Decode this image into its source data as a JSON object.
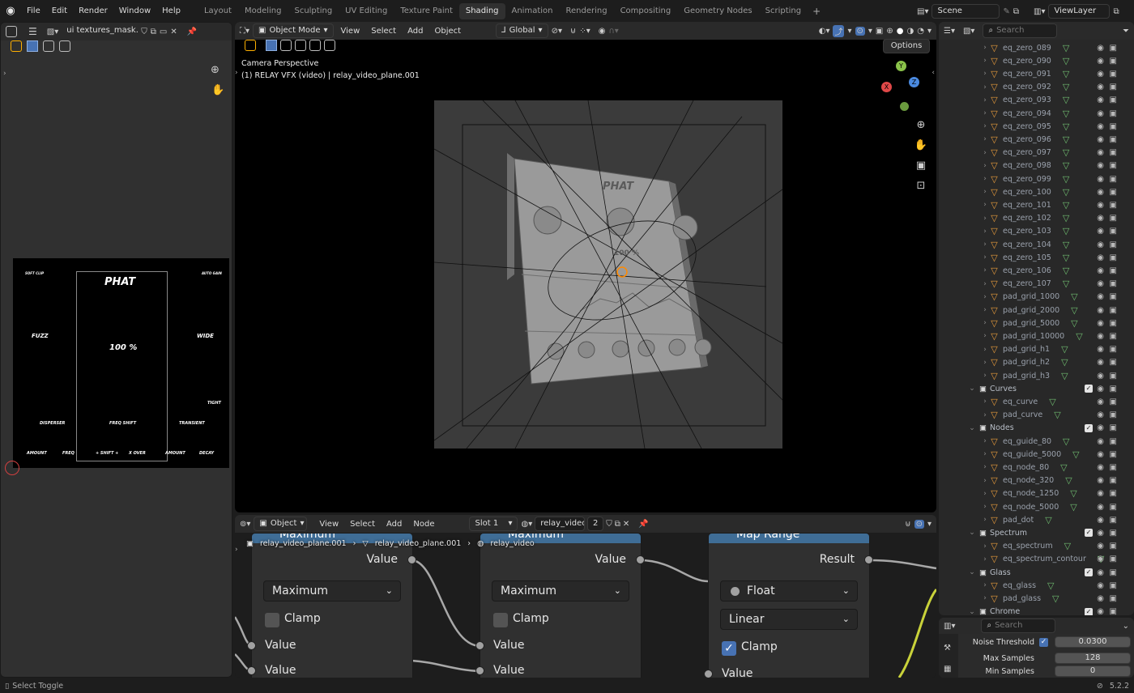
{
  "top_menu": {
    "items": [
      "File",
      "Edit",
      "Render",
      "Window",
      "Help"
    ]
  },
  "workspaces": [
    {
      "label": "Layout",
      "active": false
    },
    {
      "label": "Modeling",
      "active": false
    },
    {
      "label": "Sculpting",
      "active": false
    },
    {
      "label": "UV Editing",
      "active": false
    },
    {
      "label": "Texture Paint",
      "active": false
    },
    {
      "label": "Shading",
      "active": true
    },
    {
      "label": "Animation",
      "active": false
    },
    {
      "label": "Rendering",
      "active": false
    },
    {
      "label": "Compositing",
      "active": false
    },
    {
      "label": "Geometry Nodes",
      "active": false
    },
    {
      "label": "Scripting",
      "active": false
    }
  ],
  "add_workspace": "+",
  "scene": {
    "name": "Scene"
  },
  "view_layer": {
    "name": "ViewLayer"
  },
  "image_editor": {
    "image_name": "ui textures_mask.png",
    "texture_labels": {
      "soft_clip": "SOFT CLIP",
      "auto_gain": "AUTO GAIN",
      "title": "PHAT",
      "fuzz": "FUZZ",
      "wide": "WIDE",
      "percent": "100 %",
      "tight": "TIGHT",
      "disperser": "DISPERSER",
      "freq_shift": "FREQ SHIFT",
      "transient": "TRANSIENT",
      "amount_left": "AMOUNT",
      "freq": "FREQ",
      "shift": "+ SHIFT +",
      "x_over": "X OVER",
      "amount_right": "AMOUNT",
      "decay": "DECAY"
    }
  },
  "viewport": {
    "mode": "Object Mode",
    "menus": [
      "View",
      "Select",
      "Add",
      "Object"
    ],
    "orientation": "Global",
    "options": "Options",
    "camera_label": "Camera Perspective",
    "object_label": "(1) RELAY VFX (video) | relay_video_plane.001",
    "gizmo_axes": {
      "x": "X",
      "y": "Y",
      "z": "Z"
    },
    "render_labels": {
      "title": "PHAT",
      "percent": "100 %"
    }
  },
  "node_editor": {
    "editor_type": "Object",
    "menus": [
      "View",
      "Select",
      "Add",
      "Node"
    ],
    "slot": "Slot 1",
    "material": "relay_video",
    "user_count": "2",
    "breadcrumbs": [
      "relay_video_plane.001",
      "relay_video_plane.001",
      "relay_video"
    ],
    "nodes": [
      {
        "title": "Maximum",
        "output": "Value",
        "operation": "Maximum",
        "clamp_label": "Clamp",
        "clamp": false,
        "inputs": [
          "Value",
          "Value"
        ]
      },
      {
        "title": "Maximum",
        "output": "Value",
        "operation": "Maximum",
        "clamp_label": "Clamp",
        "clamp": false,
        "inputs": [
          "Value",
          "Value"
        ]
      },
      {
        "title": "Map Range",
        "output": "Result",
        "data_type": "Float",
        "interpolation": "Linear",
        "clamp_label": "Clamp",
        "clamp": true,
        "inputs": [
          "Value"
        ]
      }
    ]
  },
  "outliner": {
    "search_placeholder": "Search",
    "rows": [
      {
        "type": "object",
        "name": "eq_zero_089"
      },
      {
        "type": "object",
        "name": "eq_zero_090"
      },
      {
        "type": "object",
        "name": "eq_zero_091"
      },
      {
        "type": "object",
        "name": "eq_zero_092"
      },
      {
        "type": "object",
        "name": "eq_zero_093"
      },
      {
        "type": "object",
        "name": "eq_zero_094"
      },
      {
        "type": "object",
        "name": "eq_zero_095"
      },
      {
        "type": "object",
        "name": "eq_zero_096"
      },
      {
        "type": "object",
        "name": "eq_zero_097"
      },
      {
        "type": "object",
        "name": "eq_zero_098"
      },
      {
        "type": "object",
        "name": "eq_zero_099"
      },
      {
        "type": "object",
        "name": "eq_zero_100"
      },
      {
        "type": "object",
        "name": "eq_zero_101"
      },
      {
        "type": "object",
        "name": "eq_zero_102"
      },
      {
        "type": "object",
        "name": "eq_zero_103"
      },
      {
        "type": "object",
        "name": "eq_zero_104"
      },
      {
        "type": "object",
        "name": "eq_zero_105"
      },
      {
        "type": "object",
        "name": "eq_zero_106"
      },
      {
        "type": "object",
        "name": "eq_zero_107"
      },
      {
        "type": "object",
        "name": "pad_grid_1000"
      },
      {
        "type": "object",
        "name": "pad_grid_2000"
      },
      {
        "type": "object",
        "name": "pad_grid_5000"
      },
      {
        "type": "object",
        "name": "pad_grid_10000"
      },
      {
        "type": "object",
        "name": "pad_grid_h1"
      },
      {
        "type": "object",
        "name": "pad_grid_h2"
      },
      {
        "type": "object",
        "name": "pad_grid_h3"
      },
      {
        "type": "collection",
        "name": "Curves"
      },
      {
        "type": "object",
        "name": "eq_curve"
      },
      {
        "type": "object",
        "name": "pad_curve"
      },
      {
        "type": "collection",
        "name": "Nodes"
      },
      {
        "type": "object",
        "name": "eq_guide_80"
      },
      {
        "type": "object",
        "name": "eq_guide_5000"
      },
      {
        "type": "object",
        "name": "eq_node_80"
      },
      {
        "type": "object",
        "name": "eq_node_320"
      },
      {
        "type": "object",
        "name": "eq_node_1250"
      },
      {
        "type": "object",
        "name": "eq_node_5000"
      },
      {
        "type": "object",
        "name": "pad_dot"
      },
      {
        "type": "collection",
        "name": "Spectrum"
      },
      {
        "type": "object",
        "name": "eq_spectrum"
      },
      {
        "type": "object",
        "name": "eq_spectrum_contour"
      },
      {
        "type": "collection",
        "name": "Glass"
      },
      {
        "type": "object",
        "name": "eq_glass"
      },
      {
        "type": "object",
        "name": "pad_glass"
      },
      {
        "type": "collection",
        "name": "Chrome"
      }
    ]
  },
  "properties": {
    "search_placeholder": "Search",
    "fields": [
      {
        "label": "Noise Threshold",
        "value": "0.0300",
        "checkbox": true
      },
      {
        "label": "Max Samples",
        "value": "128"
      },
      {
        "label": "Min Samples",
        "value": "0"
      }
    ]
  },
  "status_bar": {
    "hint": "Select Toggle",
    "version": "5.2.2"
  },
  "colors": {
    "accent": "#4772b3",
    "node_header": "#3f6d96",
    "object_icon": "#e79b3c",
    "mesh_icon": "#6fbb6f"
  }
}
